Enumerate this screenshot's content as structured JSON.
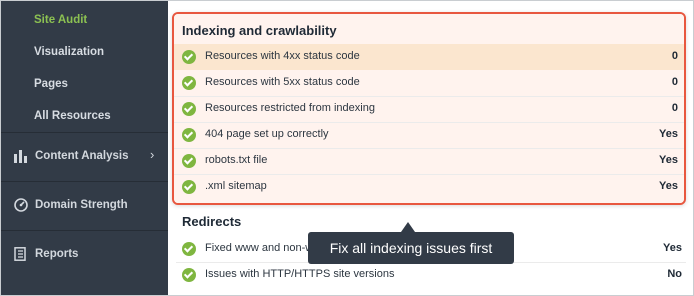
{
  "sidebar": {
    "sub_items": [
      {
        "label": "Site Audit",
        "active": true
      },
      {
        "label": "Visualization"
      },
      {
        "label": "Pages"
      },
      {
        "label": "All Resources"
      }
    ],
    "sections": [
      {
        "label": "Content Analysis",
        "icon": "content-analysis-icon"
      },
      {
        "label": "Domain Strength",
        "icon": "domain-strength-icon"
      },
      {
        "label": "Reports",
        "icon": "reports-icon"
      }
    ]
  },
  "indexing": {
    "title": "Indexing and crawlability",
    "rows": [
      {
        "label": "Resources with 4xx status code",
        "value": "0"
      },
      {
        "label": "Resources with 5xx status code",
        "value": "0"
      },
      {
        "label": "Resources restricted from indexing",
        "value": "0"
      },
      {
        "label": "404 page set up correctly",
        "value": "Yes"
      },
      {
        "label": "robots.txt file",
        "value": "Yes"
      },
      {
        "label": ".xml sitemap",
        "value": "Yes"
      }
    ]
  },
  "redirects": {
    "title": "Redirects",
    "rows": [
      {
        "label": "Fixed www and non-w",
        "value": "Yes"
      },
      {
        "label": "Issues with HTTP/HTTPS site versions",
        "value": "No"
      }
    ]
  },
  "tooltip": {
    "text": "Fix all indexing issues first"
  },
  "colors": {
    "accent_green": "#8cc152",
    "highlight_border": "#e8573f",
    "sidebar_bg": "#323b47",
    "check_green": "#7fb640"
  }
}
